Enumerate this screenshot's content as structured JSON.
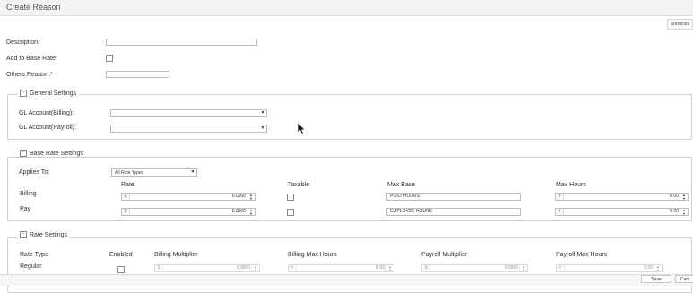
{
  "window": {
    "title": "Create Reason"
  },
  "toolbar": {
    "shortcuts_label": "Shortcuts"
  },
  "form": {
    "description_label": "Description:",
    "description_value": "",
    "add_to_base_rate_label": "Add to Base Rate:",
    "others_reason_label": "Others Reason:",
    "required_marker": "*",
    "others_reason_value": ""
  },
  "general_settings": {
    "legend": "General Settings",
    "gl_billing_label": "GL Account(Billing):",
    "gl_payroll_label": "GL Account(Payroll):",
    "gl_billing_value": "",
    "gl_payroll_value": ""
  },
  "base_rate_settings": {
    "legend": "Base Rate Settings",
    "applies_to_label": "Applies To:",
    "applies_to_value": "All Rate Types",
    "columns": {
      "rate": "Rate",
      "taxable": "Taxable",
      "max_base": "Max Base",
      "max_hours": "Max Hours"
    },
    "rows": [
      {
        "label": "Billing",
        "currency": "$",
        "rate": "0.0000",
        "max_base": "POST HOURS",
        "hours_prefix": "#",
        "max_hours": "0.00"
      },
      {
        "label": "Pay",
        "currency": "$",
        "rate": "0.0000",
        "max_base": "EMPLOYEE HOURS",
        "hours_prefix": "#",
        "max_hours": "0.00"
      }
    ]
  },
  "rate_settings": {
    "legend": "Rate Settings",
    "columns": {
      "rate_type": "Rate Type",
      "enabled": "Enabled",
      "billing_multiplier": "Billing Multiplier",
      "billing_max_hours": "Billing Max Hours",
      "payroll_multiplier": "Payroll Multiplier",
      "payroll_max_hours": "Payroll Max Hours"
    },
    "rows": [
      {
        "label": "Regular",
        "billing_multiplier": "0.0000",
        "billing_max_hours": "0.00",
        "payroll_multiplier": "0.0000",
        "payroll_max_hours": "0.00",
        "currency": "$",
        "hours_prefix": "#"
      }
    ]
  },
  "footer": {
    "save_label": "Save",
    "cancel_label": "Can"
  },
  "icons": {
    "toggle": "collapse-icon",
    "dropdown": "chevron-down-icon",
    "spinner": "spinner-icon",
    "cursor": "mouse-cursor-icon"
  }
}
